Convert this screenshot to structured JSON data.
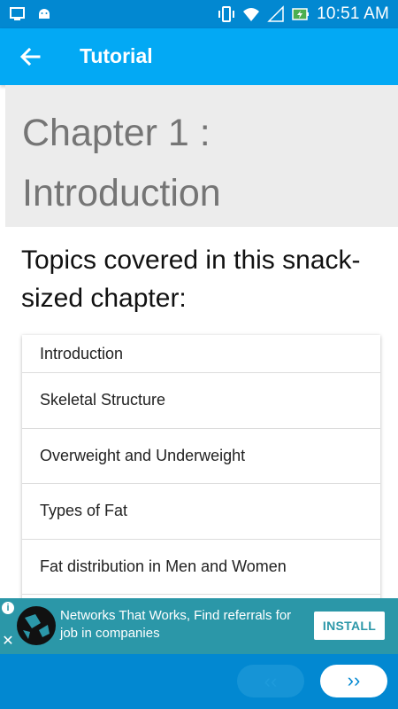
{
  "statusbar": {
    "time": "10:51 AM",
    "icons_left": [
      "screen-icon",
      "android-icon"
    ],
    "icons_right": [
      "vibrate-icon",
      "wifi-icon",
      "signal-icon",
      "battery-charging-icon"
    ]
  },
  "appbar": {
    "title": "Tutorial",
    "back_icon": "arrow-back-icon"
  },
  "chapter": {
    "title_line1": "Chapter 1 :",
    "title_line2": "Introduction"
  },
  "topics": {
    "heading": "Topics covered in this snack-sized chapter:",
    "items": [
      "Introduction",
      "Skeletal Structure",
      "Overweight and Underweight",
      "Types of Fat",
      "Fat distribution in Men and Women"
    ]
  },
  "ad": {
    "text": "Networks That Works, Find referrals for job in companies",
    "install_label": "INSTALL",
    "info_icon": "info-icon",
    "close_icon": "close-icon"
  },
  "bottom_nav": {
    "prev_label": "‹‹",
    "next_label": "››"
  },
  "colors": {
    "primary": "#03a9f4",
    "primary_dark": "#0288d1",
    "ad_bg": "#2b97a8",
    "header_bg": "#ececec"
  }
}
